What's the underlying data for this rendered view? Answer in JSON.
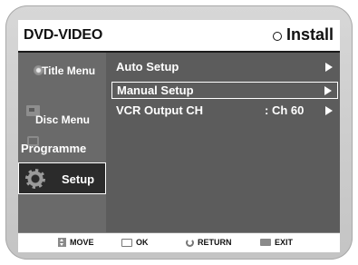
{
  "header": {
    "title": "DVD-VIDEO",
    "mode": "Install"
  },
  "sidebar": {
    "items": [
      {
        "label": "Title Menu",
        "icon": "title-menu-icon",
        "selected": false
      },
      {
        "label": "Disc Menu",
        "icon": "disc-menu-icon",
        "selected": false
      },
      {
        "label": "Programme",
        "icon": "programme-icon",
        "selected": false
      },
      {
        "label": "Setup",
        "icon": "setup-gear-icon",
        "selected": true
      }
    ]
  },
  "menu": {
    "items": [
      {
        "label": "Auto Setup",
        "value": "",
        "selected": false
      },
      {
        "label": "Manual Setup",
        "value": "",
        "selected": true
      },
      {
        "label": "VCR Output CH",
        "value": ": Ch 60",
        "selected": false
      }
    ]
  },
  "footer": {
    "move": "MOVE",
    "ok": "OK",
    "return": "RETURN",
    "exit": "EXIT"
  },
  "colors": {
    "screen_bg": "#5c5c5c",
    "sidebar_bg": "#6a6a6a",
    "selected_bg": "#2b2b2b",
    "text": "#ffffff",
    "bezel": "#cccccc"
  }
}
